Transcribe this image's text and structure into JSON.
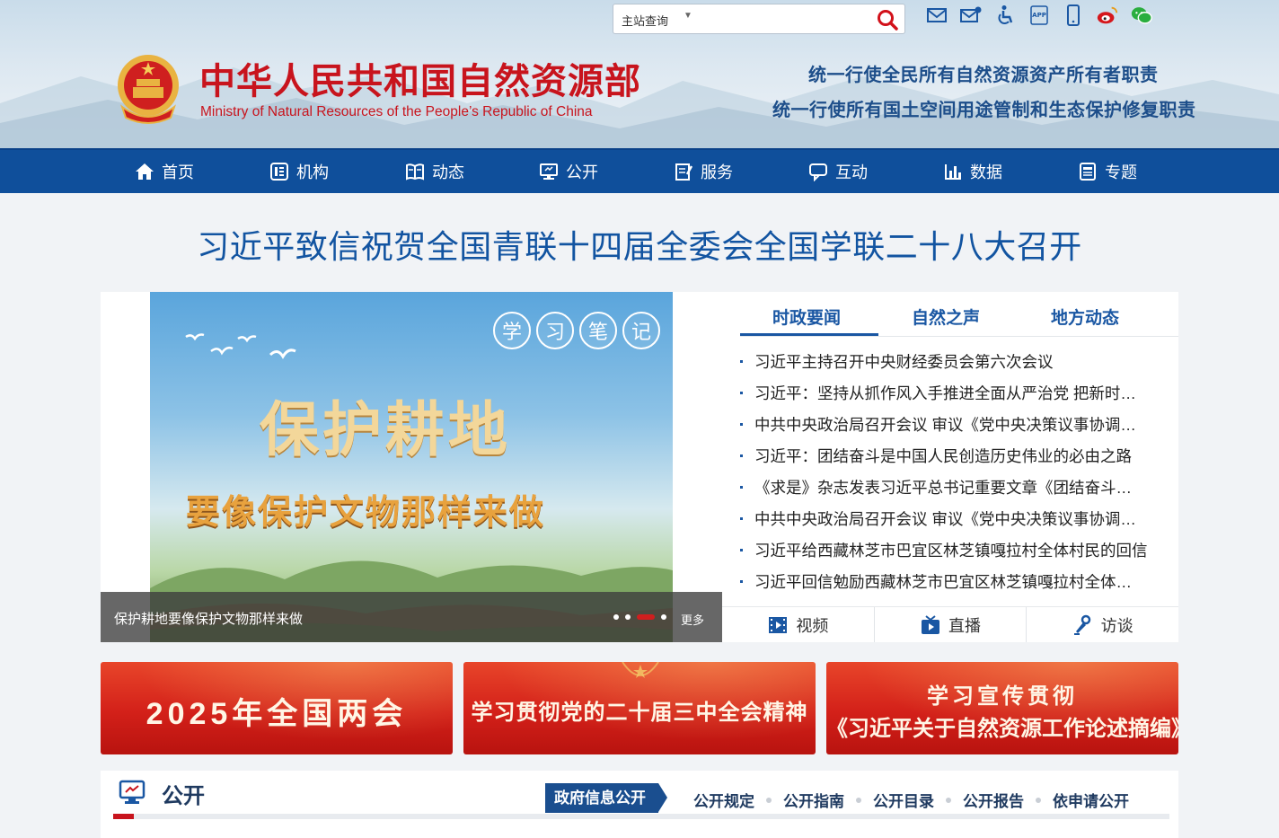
{
  "search": {
    "scope": "主站查询",
    "placeholder": ""
  },
  "header": {
    "title": "中华人民共和国自然资源部",
    "subtitle": "Ministry of Natural Resources of the People’s Republic of China",
    "motto_1": "统一行使全民所有自然资源资产所有者职责",
    "motto_2": "统一行使所有国土空间用途管制和生态保护修复职责",
    "top_icons": [
      "mail-icon",
      "mailbox-icon",
      "accessibility-icon",
      "app-icon",
      "mobile-icon",
      "weibo-icon",
      "wechat-icon"
    ]
  },
  "nav": {
    "items": [
      {
        "label": "首页",
        "icon": "home-icon"
      },
      {
        "label": "机构",
        "icon": "org-icon"
      },
      {
        "label": "动态",
        "icon": "news-icon"
      },
      {
        "label": "公开",
        "icon": "public-icon"
      },
      {
        "label": "服务",
        "icon": "service-icon"
      },
      {
        "label": "互动",
        "icon": "chat-icon"
      },
      {
        "label": "数据",
        "icon": "chart-icon"
      },
      {
        "label": "专题",
        "icon": "topic-icon"
      }
    ]
  },
  "headline": "习近平致信祝贺全国青联十四届全委会全国学联二十八大召开",
  "slide": {
    "badge": [
      "学",
      "习",
      "笔",
      "记"
    ],
    "big_line_1": "保护耕地",
    "big_line_2": "要像保护文物那样来做",
    "caption": "保护耕地要像保护文物那样来做",
    "more": "更多",
    "active_dot": 3,
    "dot_count": 4
  },
  "tabs": [
    "时政要闻",
    "自然之声",
    "地方动态"
  ],
  "news": [
    "习近平主持召开中央财经委员会第六次会议",
    "习近平：坚持从抓作风入手推进全面从严治党 把新时…",
    "中共中央政治局召开会议 审议《党中央决策议事协调…",
    "习近平：团结奋斗是中国人民创造历史伟业的必由之路",
    "《求是》杂志发表习近平总书记重要文章《团结奋斗…",
    "中共中央政治局召开会议 审议《党中央决策议事协调…",
    "习近平给西藏林芝市巴宜区林芝镇嘎拉村全体村民的回信",
    "习近平回信勉励西藏林芝市巴宜区林芝镇嘎拉村全体…"
  ],
  "media": [
    {
      "label": "视频",
      "icon": "video-icon"
    },
    {
      "label": "直播",
      "icon": "live-icon"
    },
    {
      "label": "访谈",
      "icon": "interview-icon"
    }
  ],
  "banners": {
    "b1": "2025年全国两会",
    "b2": "学习贯彻党的二十届三中全会精神",
    "b3_line1": "学习宣传贯彻",
    "b3_line2": "《习近平关于自然资源工作论述摘编》"
  },
  "public": {
    "title": "公开",
    "active": "政府信息公开",
    "links": [
      "公开规定",
      "公开指南",
      "公开目录",
      "公开报告",
      "依申请公开"
    ]
  },
  "colors": {
    "brand_red": "#c8141d",
    "nav_blue": "#0f4f9b",
    "headline_blue": "#1254a1"
  }
}
